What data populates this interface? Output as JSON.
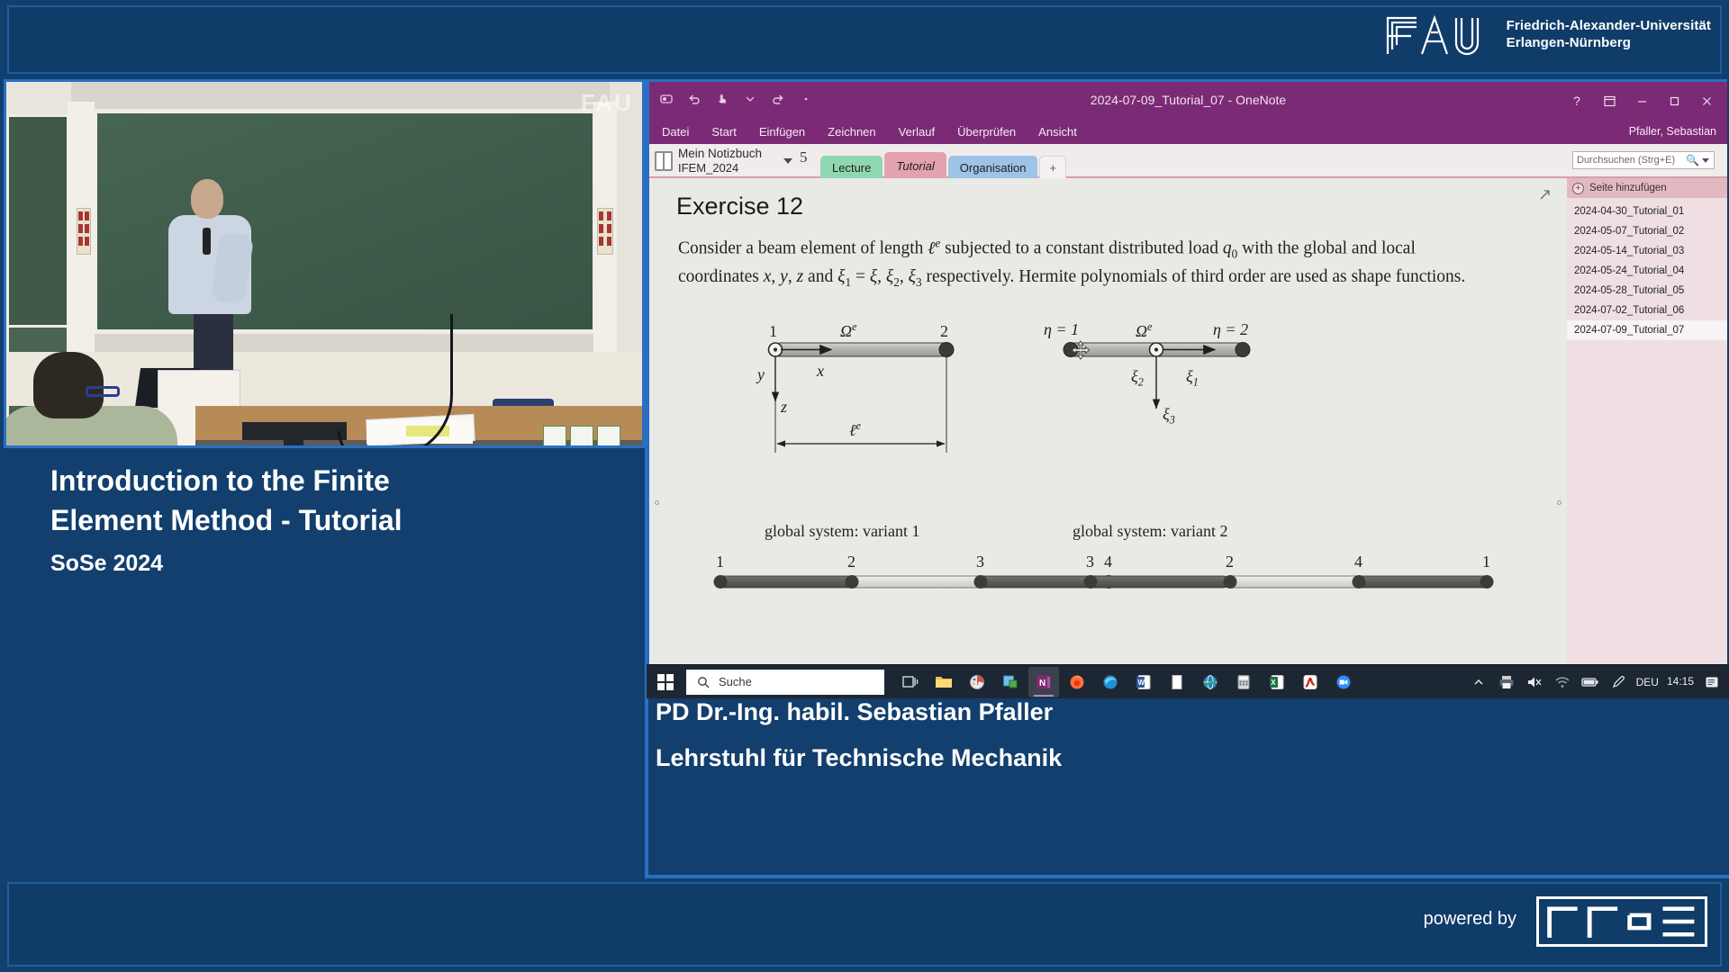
{
  "header": {
    "university_name_line1": "Friedrich-Alexander-Universität",
    "university_name_line2": "Erlangen-Nürnberg",
    "logo_text": "FAU"
  },
  "video": {
    "watermark": "FAU"
  },
  "lecture": {
    "title_line1": "Introduction to the Finite",
    "title_line2": "Element Method - Tutorial",
    "term": "SoSe 2024"
  },
  "presenter": {
    "name": "PD Dr.-Ing. habil. Sebastian Pfaller",
    "chair": "Lehrstuhl für Technische Mechanik"
  },
  "footer": {
    "powered_by": "powered by",
    "logo_name": "RRZE"
  },
  "onenote": {
    "window_title": "2024-07-09_Tutorial_07 - OneNote",
    "quick_access": [
      "autosave-icon",
      "undo-icon",
      "touch-mode-icon",
      "redo-icon",
      "more-icon"
    ],
    "window_controls": {
      "help": "?",
      "ribbon_display": "ribbon-display-icon",
      "minimize": "–",
      "restore": "restore-icon",
      "close": "✕"
    },
    "menus": [
      "Datei",
      "Start",
      "Einfügen",
      "Zeichnen",
      "Verlauf",
      "Überprüfen",
      "Ansicht"
    ],
    "user": "Pfaller, Sebastian",
    "notebook": {
      "name": "Mein Notizbuch",
      "subname": "IFEM_2024",
      "count": "5"
    },
    "section_tabs": [
      {
        "label": "Lecture",
        "color": "#8fd7b0",
        "selected": false
      },
      {
        "label": "Tutorial",
        "color": "#e3a2ae",
        "selected": true
      },
      {
        "label": "Organisation",
        "color": "#9dc3e6",
        "selected": false
      },
      {
        "label": "+",
        "color": "#f5f1f1",
        "selected": false
      }
    ],
    "search": {
      "placeholder": "Durchsuchen (Strg+E)",
      "value": ""
    },
    "page_panel": {
      "add_page_label": "Seite hinzufügen",
      "pages": [
        {
          "label": "2024-04-30_Tutorial_01",
          "selected": false
        },
        {
          "label": "2024-05-07_Tutorial_02",
          "selected": false
        },
        {
          "label": "2024-05-14_Tutorial_03",
          "selected": false
        },
        {
          "label": "2024-05-24_Tutorial_04",
          "selected": false
        },
        {
          "label": "2024-05-28_Tutorial_05",
          "selected": false
        },
        {
          "label": "2024-07-02_Tutorial_06",
          "selected": false
        },
        {
          "label": "2024-07-09_Tutorial_07",
          "selected": true
        }
      ]
    },
    "page": {
      "title": "Exercise 12",
      "paragraph_plain": "Consider a beam element of length ℓe subjected to a constant distributed load q0 with the global and local coordinates x, y, z and ξ1 = ξ, ξ2, ξ3 respectively. Hermite polynomials of third order are used as shape functions.",
      "paragraph_parts": {
        "p1": "Consider a beam element of length ",
        "len_sym": "ℓ",
        "len_sup": "e",
        "p2": " subjected to a constant distributed load ",
        "q_sym": "q",
        "q_sub": "0",
        "p3": " with the global and local coordinates ",
        "x": "x",
        "y": "y",
        "z": "z",
        "p4": " and ",
        "xi1": "ξ",
        "xi1_sub": "1",
        "eq": " = ",
        "xi": "ξ",
        "xi2": "ξ",
        "xi2_sub": "2",
        "xi3": "ξ",
        "xi3_sub": "3",
        "p5": " respectively. Hermite polynomials of third order are used as shape functions."
      },
      "diagram_left": {
        "node_labels": [
          "1",
          "2"
        ],
        "domain_label": "Ω",
        "domain_sup": "e",
        "axis_x": "x",
        "axis_y": "y",
        "axis_z": "z",
        "length_label": "ℓ",
        "length_sup": "e"
      },
      "diagram_right": {
        "eta_left": "η = 1",
        "eta_right": "η = 2",
        "domain_label": "Ω",
        "domain_sup": "e",
        "xi1": "ξ",
        "xi1_sub": "1",
        "xi2": "ξ",
        "xi2_sub": "2",
        "xi3": "ξ",
        "xi3_sub": "3"
      },
      "global_variant_1": {
        "caption": "global system: variant 1",
        "node_numbers": [
          "1",
          "2",
          "3",
          "4"
        ]
      },
      "global_variant_2": {
        "caption": "global system: variant 2",
        "node_numbers": [
          "3",
          "2",
          "4",
          "1"
        ]
      }
    }
  },
  "taskbar": {
    "search_placeholder": "Suche",
    "apps": [
      {
        "name": "task-view-icon",
        "label": "Taskansicht"
      },
      {
        "name": "file-explorer-icon",
        "label": "Explorer"
      },
      {
        "name": "paint-icon",
        "label": "Paint"
      },
      {
        "name": "snipping-tool-icon",
        "label": "Snipping Tool"
      },
      {
        "name": "onenote-icon",
        "label": "OneNote",
        "active": true
      },
      {
        "name": "firefox-icon",
        "label": "Firefox"
      },
      {
        "name": "edge-icon",
        "label": "Edge"
      },
      {
        "name": "word-icon",
        "label": "Word"
      },
      {
        "name": "notepad-icon",
        "label": "Editor"
      },
      {
        "name": "browser-icon",
        "label": "Browser"
      },
      {
        "name": "calculator-icon",
        "label": "Rechner"
      },
      {
        "name": "excel-icon",
        "label": "Excel"
      },
      {
        "name": "acrobat-icon",
        "label": "Acrobat Reader"
      },
      {
        "name": "zoom-icon",
        "label": "Zoom"
      }
    ],
    "tray": {
      "chevron": "⌃",
      "items": [
        "printer-icon",
        "volume-muted-icon",
        "wifi-icon",
        "battery-icon",
        "pen-icon"
      ],
      "language": "DEU",
      "time": "14:15",
      "notifications": "notification-icon"
    }
  },
  "colors": {
    "fau_blue": "#113f6e",
    "fau_border_blue": "#1f5d9e",
    "onenote_purple": "#7b2b75",
    "tab_tutorial": "#e3a2ae",
    "tab_lecture": "#8fd7b0",
    "tab_organisation": "#9dc3e6",
    "taskbar": "#1d2733",
    "video_border": "#2a6fc4"
  }
}
